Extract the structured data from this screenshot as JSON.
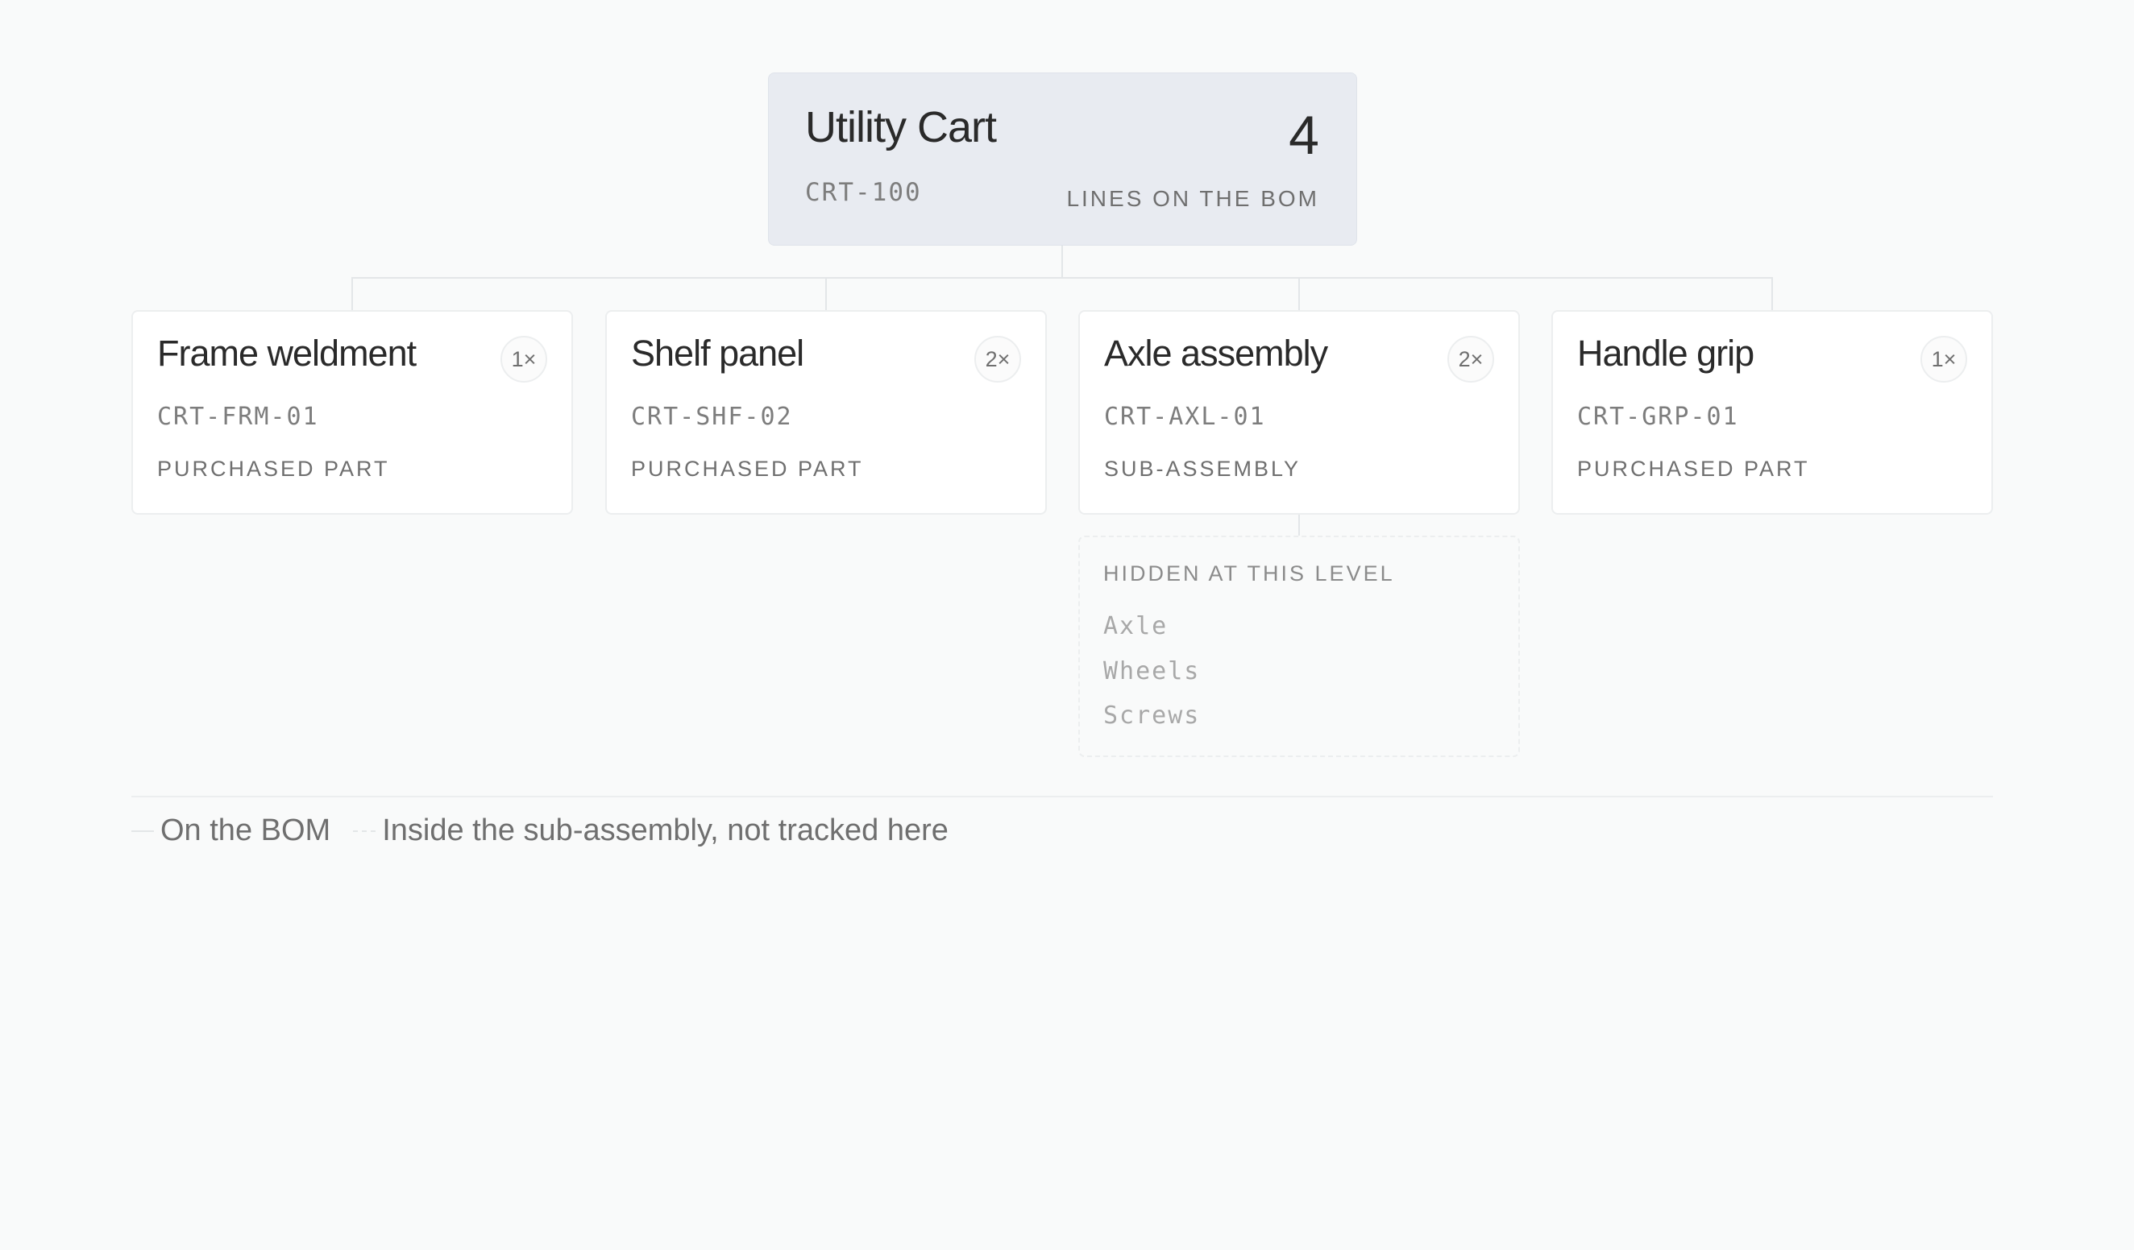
{
  "root": {
    "name": "Utility Cart",
    "code": "CRT-100",
    "count": "4",
    "count_label": "LINES ON THE BOM"
  },
  "children": [
    {
      "name": "Frame weldment",
      "qty": "1×",
      "code": "CRT-FRM-01",
      "type": "PURCHASED PART"
    },
    {
      "name": "Shelf panel",
      "qty": "2×",
      "code": "CRT-SHF-02",
      "type": "PURCHASED PART"
    },
    {
      "name": "Axle assembly",
      "qty": "2×",
      "code": "CRT-AXL-01",
      "type": "SUB-ASSEMBLY"
    },
    {
      "name": "Handle grip",
      "qty": "1×",
      "code": "CRT-GRP-01",
      "type": "PURCHASED PART"
    }
  ],
  "hidden": {
    "title": "HIDDEN AT THIS LEVEL",
    "items": [
      "Axle",
      "Wheels",
      "Screws"
    ]
  },
  "legend": {
    "on_bom": "On the BOM",
    "inside_sub": "Inside the sub-assembly, not tracked here"
  }
}
